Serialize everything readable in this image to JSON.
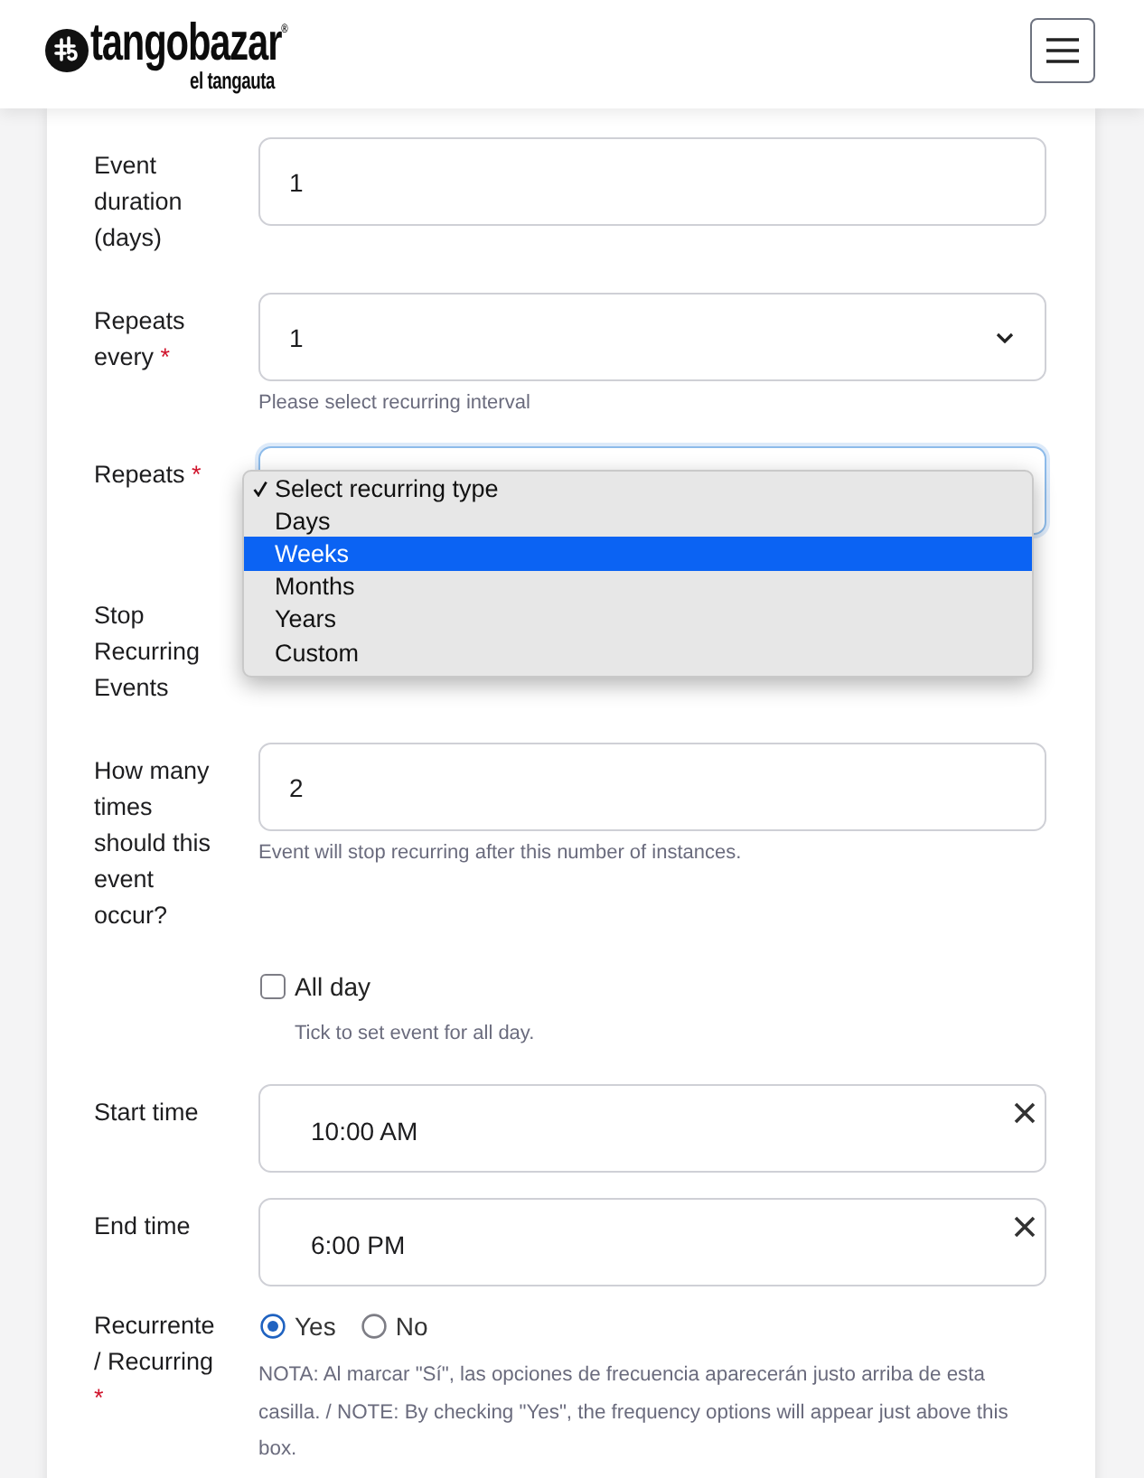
{
  "header": {
    "logo": {
      "name": "tangobazar$^{®}$",
      "tagline": "el tangauta"
    }
  },
  "form": {
    "fields": [
      {
        "kind": "number",
        "label": "Event duration (days)",
        "value": "1"
      },
      {
        "kind": "select",
        "label": "Repeats every",
        "required_mark": "*",
        "value": "1",
        "focused": false,
        "hint": "Please select recurring interval"
      },
      {
        "kind": "select",
        "label": "Repeats",
        "required_mark": "*",
        "focused": true,
        "dropdown": {
          "options": [
            {
              "label": "Select recurring type",
              "selected": true,
              "highlighted": false
            },
            {
              "label": "Days",
              "selected": false,
              "highlighted": false
            },
            {
              "label": "Weeks",
              "selected": false,
              "highlighted": true
            },
            {
              "label": "Months",
              "selected": false,
              "highlighted": false
            },
            {
              "label": "Years",
              "selected": false,
              "highlighted": false
            },
            {
              "label": "Custom",
              "selected": false,
              "highlighted": false
            }
          ]
        }
      },
      {
        "kind": "covered",
        "label": "Stop Recurring Events"
      },
      {
        "kind": "number",
        "label": "How many times should this event occur?",
        "value": "2",
        "hint": "Event will stop recurring after this number of instances."
      },
      {
        "kind": "checkbox",
        "option": "All day",
        "checked": false,
        "hint": "Tick to set event for all day."
      },
      {
        "kind": "time",
        "label": "Start time",
        "value": "10:00 AM"
      },
      {
        "kind": "time",
        "label": "End time",
        "value": "6:00 PM"
      },
      {
        "kind": "radio",
        "label": "Recurrente / Recurring",
        "required_mark": "*",
        "options": [
          {
            "label": "Yes",
            "selected": true
          },
          {
            "label": "No",
            "selected": false
          }
        ],
        "note": "NOTA: Al marcar \"Sí\", las opciones de frecuencia aparecerán justo arriba de esta casilla. / NOTE: By checking \"Yes\", the frequency options will appear just above this box."
      }
    ]
  }
}
